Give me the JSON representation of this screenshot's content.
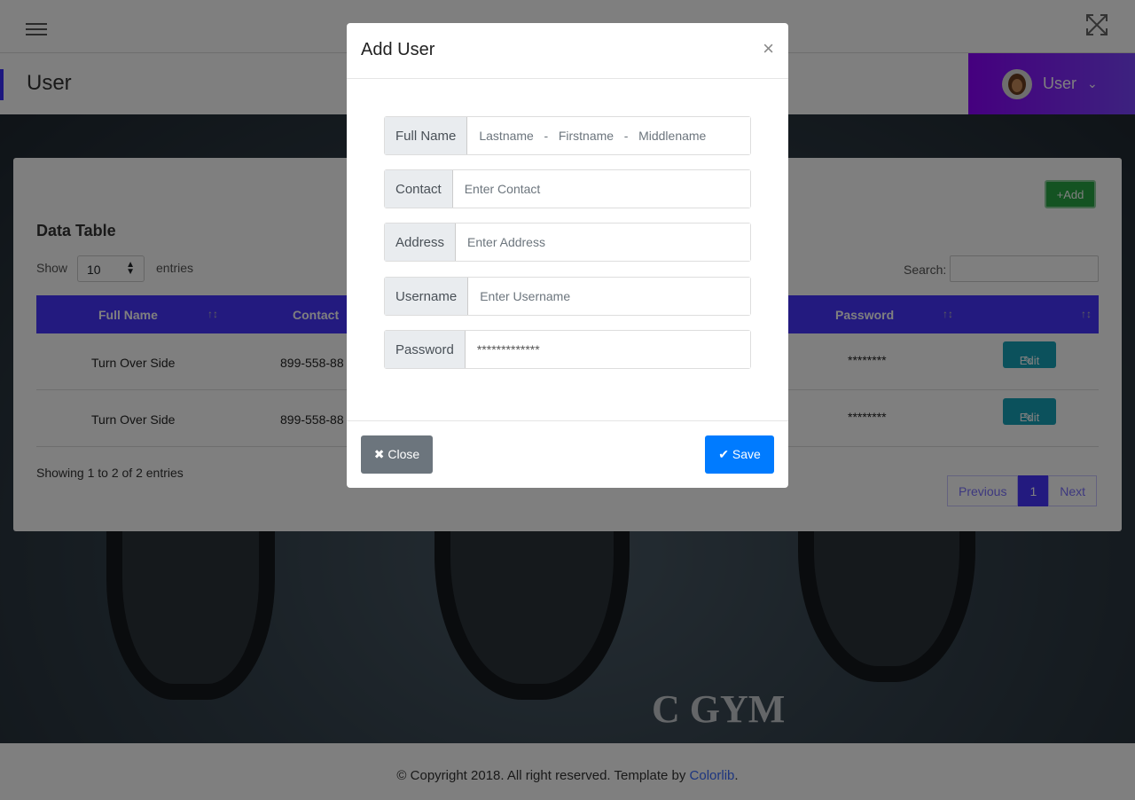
{
  "header": {
    "menu_icon": "hamburger-icon",
    "fullscreen_icon": "expand-icon",
    "page_title": "User",
    "user_label": "User",
    "accent": "#4634ff"
  },
  "card": {
    "add_label": "+Add",
    "title": "Data Table",
    "show_label": "Show",
    "entries_value": "10",
    "entries_label": "entries",
    "search_label": "Search:",
    "columns": [
      "Full Name",
      "Contact",
      "Password"
    ],
    "rows": [
      {
        "name": "Turn Over Side",
        "contact": "899-558-88",
        "password": "********",
        "action": "Edit"
      },
      {
        "name": "Turn Over Side",
        "contact": "899-558-88",
        "password": "********",
        "action": "Edit"
      }
    ],
    "info": "Showing 1 to 2 of 2 entries",
    "pager": {
      "prev": "Previous",
      "page": "1",
      "next": "Next"
    }
  },
  "footer": {
    "text": "© Copyright 2018. All right reserved. Template by ",
    "link": "Colorlib",
    "end": "."
  },
  "background": {
    "text": "C GYM"
  },
  "modal": {
    "title": "Add User",
    "close_icon": "×",
    "fields": [
      {
        "label": "Full Name",
        "placeholder": "Lastname   -   Firstname   -   Middlename",
        "value": ""
      },
      {
        "label": "Contact",
        "placeholder": "Enter Contact",
        "value": ""
      },
      {
        "label": "Address",
        "placeholder": "Enter Address",
        "value": ""
      },
      {
        "label": "Username",
        "placeholder": "Enter Username",
        "value": ""
      },
      {
        "label": "Password",
        "placeholder": "",
        "value": "*************"
      }
    ],
    "close_label": "✖ Close",
    "save_label": "✔ Save"
  }
}
